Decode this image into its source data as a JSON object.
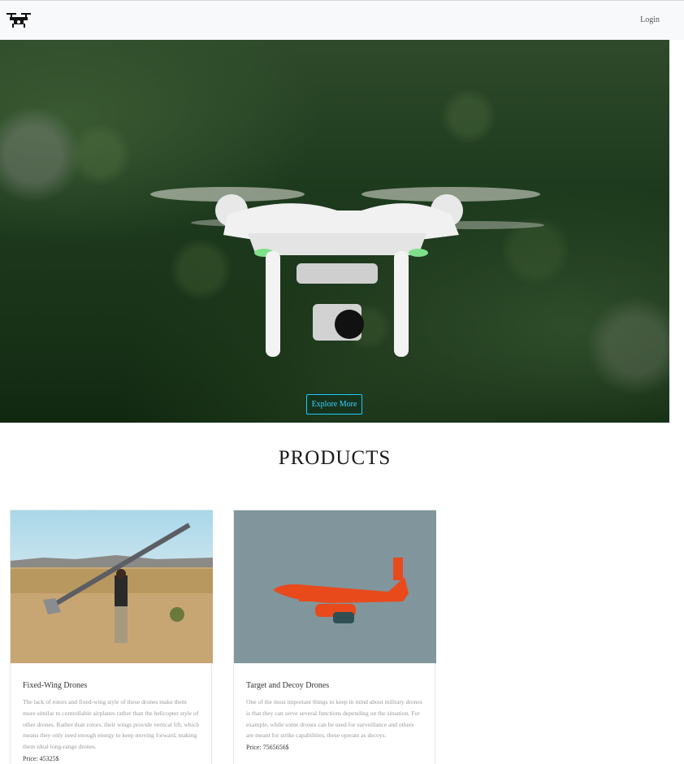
{
  "navbar": {
    "logo_icon": "drone-icon",
    "login_label": "Login"
  },
  "hero": {
    "explore_label": "Explore More",
    "accent_color": "#1ec8ff"
  },
  "products": {
    "title": "PRODUCTS",
    "items": [
      {
        "title": "Fixed-Wing Drones",
        "description": "The lack of rotors and fixed-wing style of these drones make them more similar to controllable airplanes rather than the helicopter style of other drones. Rather than rotors, their wings provide vertical lift, which means they only need enough energy to keep moving forward, making them ideal long-range drones.",
        "price": "Price: 45325$"
      },
      {
        "title": "Target and Decoy Drones",
        "description": "One of the most important things to keep in mind about military drones is that they can serve several functions depending on the situation. For example, while some drones can be used for surveillance and others are meant for strike capabilities, these operate as decoys.",
        "price": "Price: 7565656$"
      }
    ]
  }
}
